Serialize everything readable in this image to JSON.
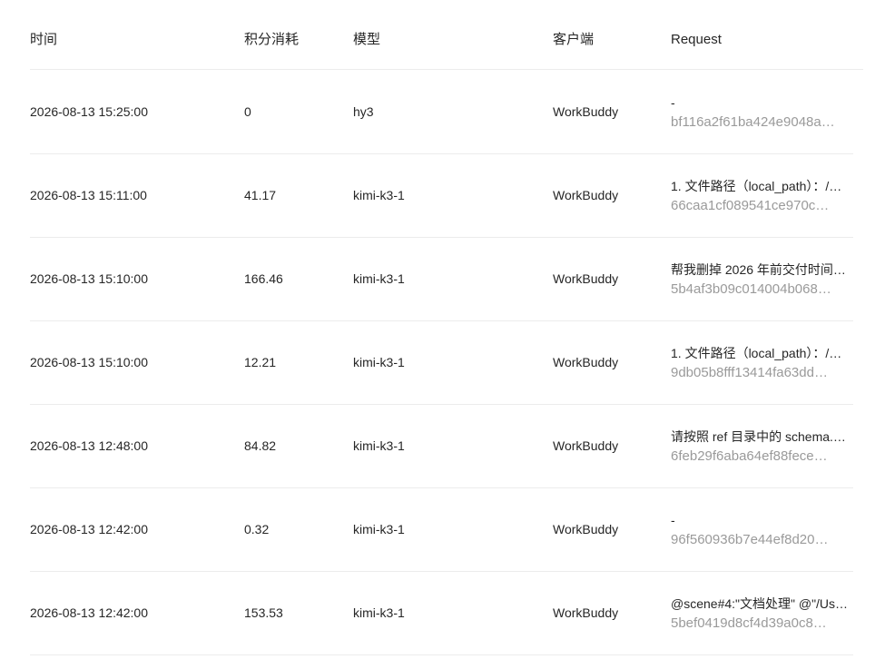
{
  "columns": {
    "time": "时间",
    "points": "积分消耗",
    "model": "模型",
    "client": "客户端",
    "request": "Request"
  },
  "rows": [
    {
      "time": "2026-08-13 15:25:00",
      "points": "0",
      "model": "hy3",
      "client": "WorkBuddy",
      "request_text": "-",
      "request_id": "bf116a2f61ba424e9048a…"
    },
    {
      "time": "2026-08-13 15:11:00",
      "points": "41.17",
      "model": "kimi-k3-1",
      "client": "WorkBuddy",
      "request_text": "1. 文件路径（local_path）：/…",
      "request_id": "66caa1cf089541ce970c…"
    },
    {
      "time": "2026-08-13 15:10:00",
      "points": "166.46",
      "model": "kimi-k3-1",
      "client": "WorkBuddy",
      "request_text": "帮我删掉 2026 年前交付时间…",
      "request_id": "5b4af3b09c014004b068…"
    },
    {
      "time": "2026-08-13 15:10:00",
      "points": "12.21",
      "model": "kimi-k3-1",
      "client": "WorkBuddy",
      "request_text": "1. 文件路径（local_path）：/…",
      "request_id": "9db05b8fff13414fa63dd…"
    },
    {
      "time": "2026-08-13 12:48:00",
      "points": "84.82",
      "model": "kimi-k3-1",
      "client": "WorkBuddy",
      "request_text": "请按照 ref 目录中的 schema.…",
      "request_id": "6feb29f6aba64ef88fece…"
    },
    {
      "time": "2026-08-13 12:42:00",
      "points": "0.32",
      "model": "kimi-k3-1",
      "client": "WorkBuddy",
      "request_text": "-",
      "request_id": "96f560936b7e44ef8d20…"
    },
    {
      "time": "2026-08-13 12:42:00",
      "points": "153.53",
      "model": "kimi-k3-1",
      "client": "WorkBuddy",
      "request_text": "@scene#4:\"文档处理\" @\"/Us…",
      "request_id": "5bef0419d8cf4d39a0c8…"
    }
  ]
}
